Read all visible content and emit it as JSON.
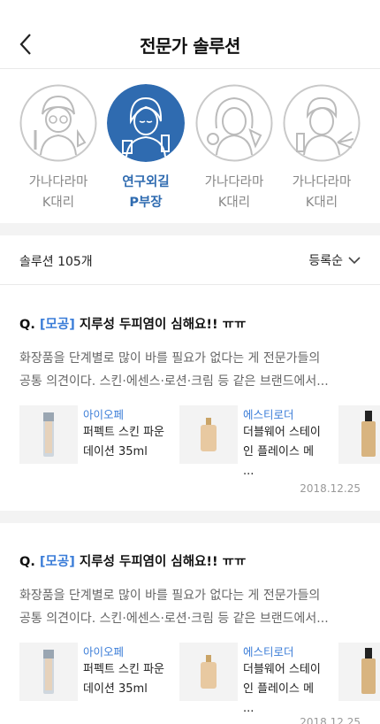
{
  "header": {
    "title": "전문가 솔루션"
  },
  "experts": [
    {
      "name": "가나다라마",
      "role": "K대리",
      "active": false
    },
    {
      "name": "연구외길",
      "role": "P부장",
      "active": true
    },
    {
      "name": "가나다라마",
      "role": "K대리",
      "active": false
    },
    {
      "name": "가나다라마",
      "role": "K대리",
      "active": false
    }
  ],
  "solutions": {
    "count_label": "솔루션 105개",
    "sort_label": "등록순"
  },
  "cards": [
    {
      "q_prefix": "Q.",
      "tag": "[모공]",
      "question": "지루성 두피염이 심해요!! ㅠㅠ",
      "answer_lines": [
        "화장품을 단계별로 많이 바를 필요가 없다는 게 전문가들의",
        "공통 의견이다. 스킨·에센스·로션·크림 등 같은 브랜드에서..."
      ],
      "products": [
        {
          "brand": "아이오페",
          "name": "퍼펙트 스킨 파운데이션 35ml"
        },
        {
          "brand": "에스티로더",
          "name": "더블웨어 스테이 인 플레이스 메 ..."
        }
      ],
      "date": "2018.12.25"
    },
    {
      "q_prefix": "Q.",
      "tag": "[모공]",
      "question": "지루성 두피염이 심해요!! ㅠㅠ",
      "answer_lines": [
        "화장품을 단계별로 많이 바를 필요가 없다는 게 전문가들의",
        "공통 의견이다. 스킨·에센스·로션·크림 등 같은 브랜드에서..."
      ],
      "products": [
        {
          "brand": "아이오페",
          "name": "퍼펙트 스킨 파운데이션 35ml"
        },
        {
          "brand": "에스티로더",
          "name": "더블웨어 스테이 인 플레이스 메 ..."
        }
      ],
      "date": "2018.12.25"
    }
  ],
  "colors": {
    "accent": "#2f6bb0",
    "tag": "#3b7dd8",
    "divider": "#f3f3f3"
  }
}
